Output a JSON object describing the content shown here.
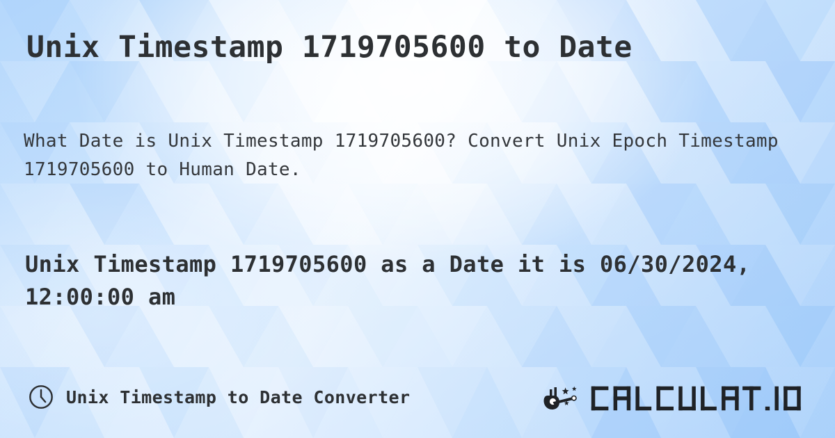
{
  "page": {
    "title": "Unix Timestamp 1719705600 to Date",
    "description": "What Date is Unix Timestamp 1719705600? Convert Unix Epoch Timestamp 1719705600 to Human Date.",
    "result": "Unix Timestamp 1719705600 as a Date it is 06/30/2024, 12:00:00 am"
  },
  "values": {
    "timestamp": "1719705600",
    "human_date": "06/30/2024, 12:00:00 am"
  },
  "footer": {
    "label": "Unix Timestamp to Date Converter",
    "clock_icon": "clock-icon",
    "brand_mark_icon": "magic-wand-hand-icon",
    "brand_name": "CALCULAT.IO"
  },
  "colors": {
    "text": "#2d3033",
    "body_text": "#34373b",
    "background_blue": "#bedcfb",
    "background_light": "#ffffff",
    "background_accent": "#8fc2f7"
  }
}
